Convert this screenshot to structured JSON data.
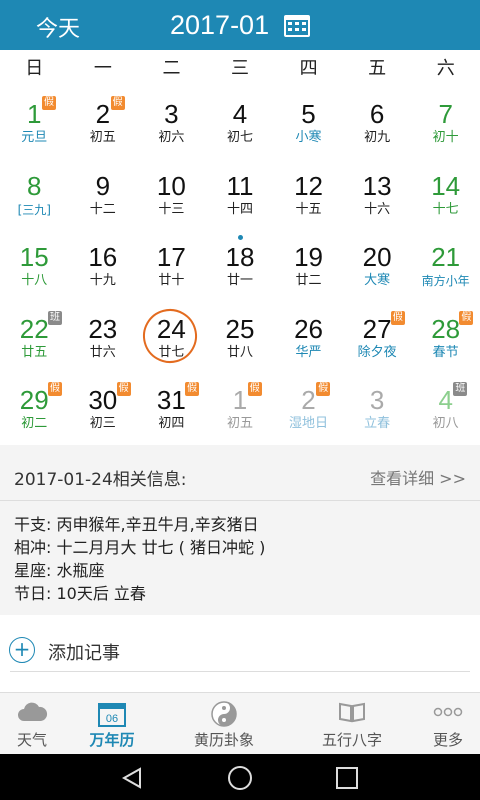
{
  "header": {
    "today_label": "今天",
    "month": "2017-01"
  },
  "weekdays": [
    "日",
    "一",
    "二",
    "三",
    "四",
    "五",
    "六"
  ],
  "days": [
    {
      "n": "1",
      "s": "元旦",
      "we": true,
      "fest": true,
      "badge": "假"
    },
    {
      "n": "2",
      "s": "初五",
      "badge": "假"
    },
    {
      "n": "3",
      "s": "初六"
    },
    {
      "n": "4",
      "s": "初七"
    },
    {
      "n": "5",
      "s": "小寒",
      "fest": true
    },
    {
      "n": "6",
      "s": "初九"
    },
    {
      "n": "7",
      "s": "初十",
      "we": true
    },
    {
      "n": "8",
      "s": "[三九]",
      "we": true,
      "fest": true
    },
    {
      "n": "9",
      "s": "十二"
    },
    {
      "n": "10",
      "s": "十三"
    },
    {
      "n": "11",
      "s": "十四"
    },
    {
      "n": "12",
      "s": "十五"
    },
    {
      "n": "13",
      "s": "十六"
    },
    {
      "n": "14",
      "s": "十七",
      "we": true
    },
    {
      "n": "15",
      "s": "十八",
      "we": true
    },
    {
      "n": "16",
      "s": "十九"
    },
    {
      "n": "17",
      "s": "廿十"
    },
    {
      "n": "18",
      "s": "廿一",
      "dot": true
    },
    {
      "n": "19",
      "s": "廿二"
    },
    {
      "n": "20",
      "s": "大寒",
      "fest": true
    },
    {
      "n": "21",
      "s": "南方小年",
      "we": true,
      "fest": true
    },
    {
      "n": "22",
      "s": "廿五",
      "we": true,
      "badge": "班"
    },
    {
      "n": "23",
      "s": "廿六"
    },
    {
      "n": "24",
      "s": "廿七",
      "selected": true
    },
    {
      "n": "25",
      "s": "廿八"
    },
    {
      "n": "26",
      "s": "华严",
      "fest": true
    },
    {
      "n": "27",
      "s": "除夕夜",
      "fest": true,
      "badge": "假"
    },
    {
      "n": "28",
      "s": "春节",
      "we": true,
      "fest": true,
      "badge": "假"
    },
    {
      "n": "29",
      "s": "初二",
      "we": true,
      "badge": "假"
    },
    {
      "n": "30",
      "s": "初三",
      "badge": "假"
    },
    {
      "n": "31",
      "s": "初四",
      "badge": "假"
    },
    {
      "n": "1",
      "s": "初五",
      "other": true,
      "badge": "假"
    },
    {
      "n": "2",
      "s": "湿地日",
      "other": true,
      "fest": true,
      "badge": "假"
    },
    {
      "n": "3",
      "s": "立春",
      "other": true,
      "fest": true
    },
    {
      "n": "4",
      "s": "初八",
      "other": true,
      "we": true,
      "badge": "班"
    }
  ],
  "info": {
    "heading": "2017-01-24相关信息:",
    "more": "查看详细 >>",
    "rows": [
      "干支: 丙申猴年,辛丑牛月,辛亥猪日",
      "相冲: 十二月月大 廿七 ( 猪日冲蛇 )",
      "星座: 水瓶座",
      "节日: 10天后 立春"
    ]
  },
  "add_note": {
    "icon": "+",
    "label": "添加记事"
  },
  "calendar_icon_day": "06",
  "tabs": [
    {
      "label": "天气",
      "icon": "cloud-icon"
    },
    {
      "label": "万年历",
      "icon": "calendar-icon",
      "active": true
    },
    {
      "label": "黄历卦象",
      "icon": "yin-yang-icon"
    },
    {
      "label": "五行八字",
      "icon": "book-icon"
    },
    {
      "label": "更多",
      "icon": "more-dots-icon"
    }
  ],
  "colors": {
    "primary": "#1e88b4",
    "weekend": "#2e9a39",
    "holiday_badge": "#f28b30",
    "work_badge": "#8a8a8a",
    "today_circle": "#e36b1f"
  }
}
